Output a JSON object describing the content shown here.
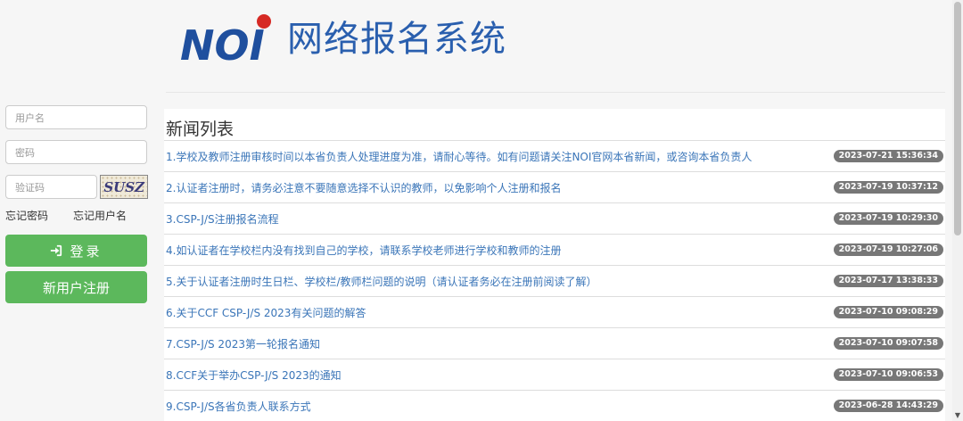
{
  "header": {
    "logo_text": "NOI",
    "title": "网络报名系统"
  },
  "login": {
    "username_placeholder": "用户名",
    "password_placeholder": "密码",
    "captcha_placeholder": "验证码",
    "captcha_text": "SUSZ",
    "forgot_password": "忘记密码",
    "forgot_username": "忘记用户名",
    "login_button": "登录",
    "register_button": "新用户注册"
  },
  "news": {
    "title": "新闻列表",
    "items": [
      {
        "text": "1.学校及教师注册审核时间以本省负责人处理进度为准，请耐心等待。如有问题请关注NOI官网本省新闻，或咨询本省负责人",
        "date": "2023-07-21 15:36:34"
      },
      {
        "text": "2.认证者注册时，请务必注意不要随意选择不认识的教师，以免影响个人注册和报名",
        "date": "2023-07-19 10:37:12"
      },
      {
        "text": "3.CSP-J/S注册报名流程",
        "date": "2023-07-19 10:29:30"
      },
      {
        "text": "4.如认证者在学校栏内没有找到自己的学校，请联系学校老师进行学校和教师的注册",
        "date": "2023-07-19 10:27:06"
      },
      {
        "text": "5.关于认证者注册时生日栏、学校栏/教师栏问题的说明（请认证者务必在注册前阅读了解）",
        "date": "2023-07-17 13:38:33"
      },
      {
        "text": "6.关于CCF CSP-J/S 2023有关问题的解答",
        "date": "2023-07-10 09:08:29"
      },
      {
        "text": "7.CSP-J/S 2023第一轮报名通知",
        "date": "2023-07-10 09:07:58"
      },
      {
        "text": "8.CCF关于举办CSP-J/S 2023的通知",
        "date": "2023-07-10 09:06:53"
      },
      {
        "text": "9.CSP-J/S各省负责人联系方式",
        "date": "2023-06-28 14:43:29"
      }
    ]
  },
  "colors": {
    "brand_blue": "#1f4f9e",
    "title_blue": "#2a5fae",
    "logo_red": "#d62a24",
    "button_green": "#5cb85c",
    "badge_gray": "#777777",
    "link_blue": "#3a75b8"
  }
}
